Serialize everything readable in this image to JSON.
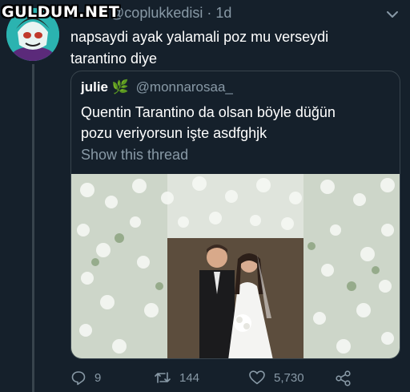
{
  "watermark": "GULDUM.NET",
  "tweet": {
    "name_tail": "iz",
    "handle": "@coplukkedisi",
    "separator": "·",
    "time": "1d",
    "text_line1": "napsaydi ayak yalamali poz mu verseydi",
    "text_line2": "tarantino diye"
  },
  "quote": {
    "name": "julie",
    "emoji": "🌿",
    "handle": "@monnarosaa_",
    "text_line1": "Quentin Tarantino da olsan böyle düğün",
    "text_line2": "pozu veriyorsun işte asdfghjk",
    "show_thread": "Show this thread"
  },
  "actions": {
    "replies": "9",
    "retweets": "144",
    "likes": "5,730"
  },
  "icons": [
    "chevron-down-icon",
    "reply-icon",
    "retweet-icon",
    "like-icon",
    "share-icon",
    "leaf-icon"
  ],
  "colors": {
    "background": "#15202b",
    "border": "#38444d",
    "secondary_text": "#8899a6"
  }
}
